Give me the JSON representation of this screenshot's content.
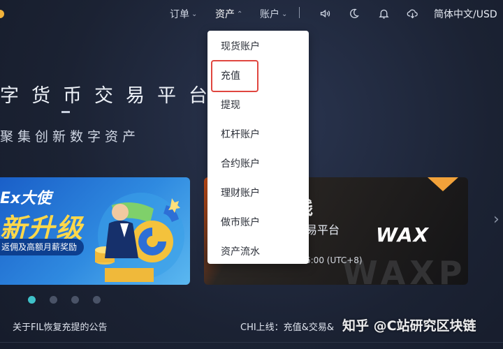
{
  "nav": {
    "orders": "订单",
    "assets": "资产",
    "account": "账户",
    "language_currency": "简体中文/USD"
  },
  "icons": [
    "volume-icon",
    "moon-icon",
    "bell-icon",
    "cloud-download-icon"
  ],
  "hero": {
    "headline": "字货币交易平台",
    "subtitle": "聚集创新数字资产"
  },
  "banners": {
    "left": {
      "top_text": "Ex大使",
      "main_text": "新升级",
      "pill_text": "返佣及高额月薪奖励"
    },
    "right": {
      "big_text": "线",
      "sub_text": "交易平台",
      "logo_text": "WAX",
      "time_text": "6:00 (UTC+8)",
      "bg_text": "WAXP"
    }
  },
  "carousel": {
    "count": 4,
    "active_index": 0
  },
  "ticker": {
    "left": "关于FIL恢复充提的公告",
    "right": "CHI上线：充值&交易&"
  },
  "watermark": "知乎 @C站研究区块链",
  "assets_menu": {
    "items": [
      "现货账户",
      "充值",
      "提现",
      "杠杆账户",
      "合约账户",
      "理财账户",
      "做市账户",
      "资产流水"
    ],
    "highlighted": "充值"
  },
  "colors": {
    "background": "#1b2233",
    "highlight_border": "#e0463f",
    "active_dot": "#3fc1c9"
  }
}
